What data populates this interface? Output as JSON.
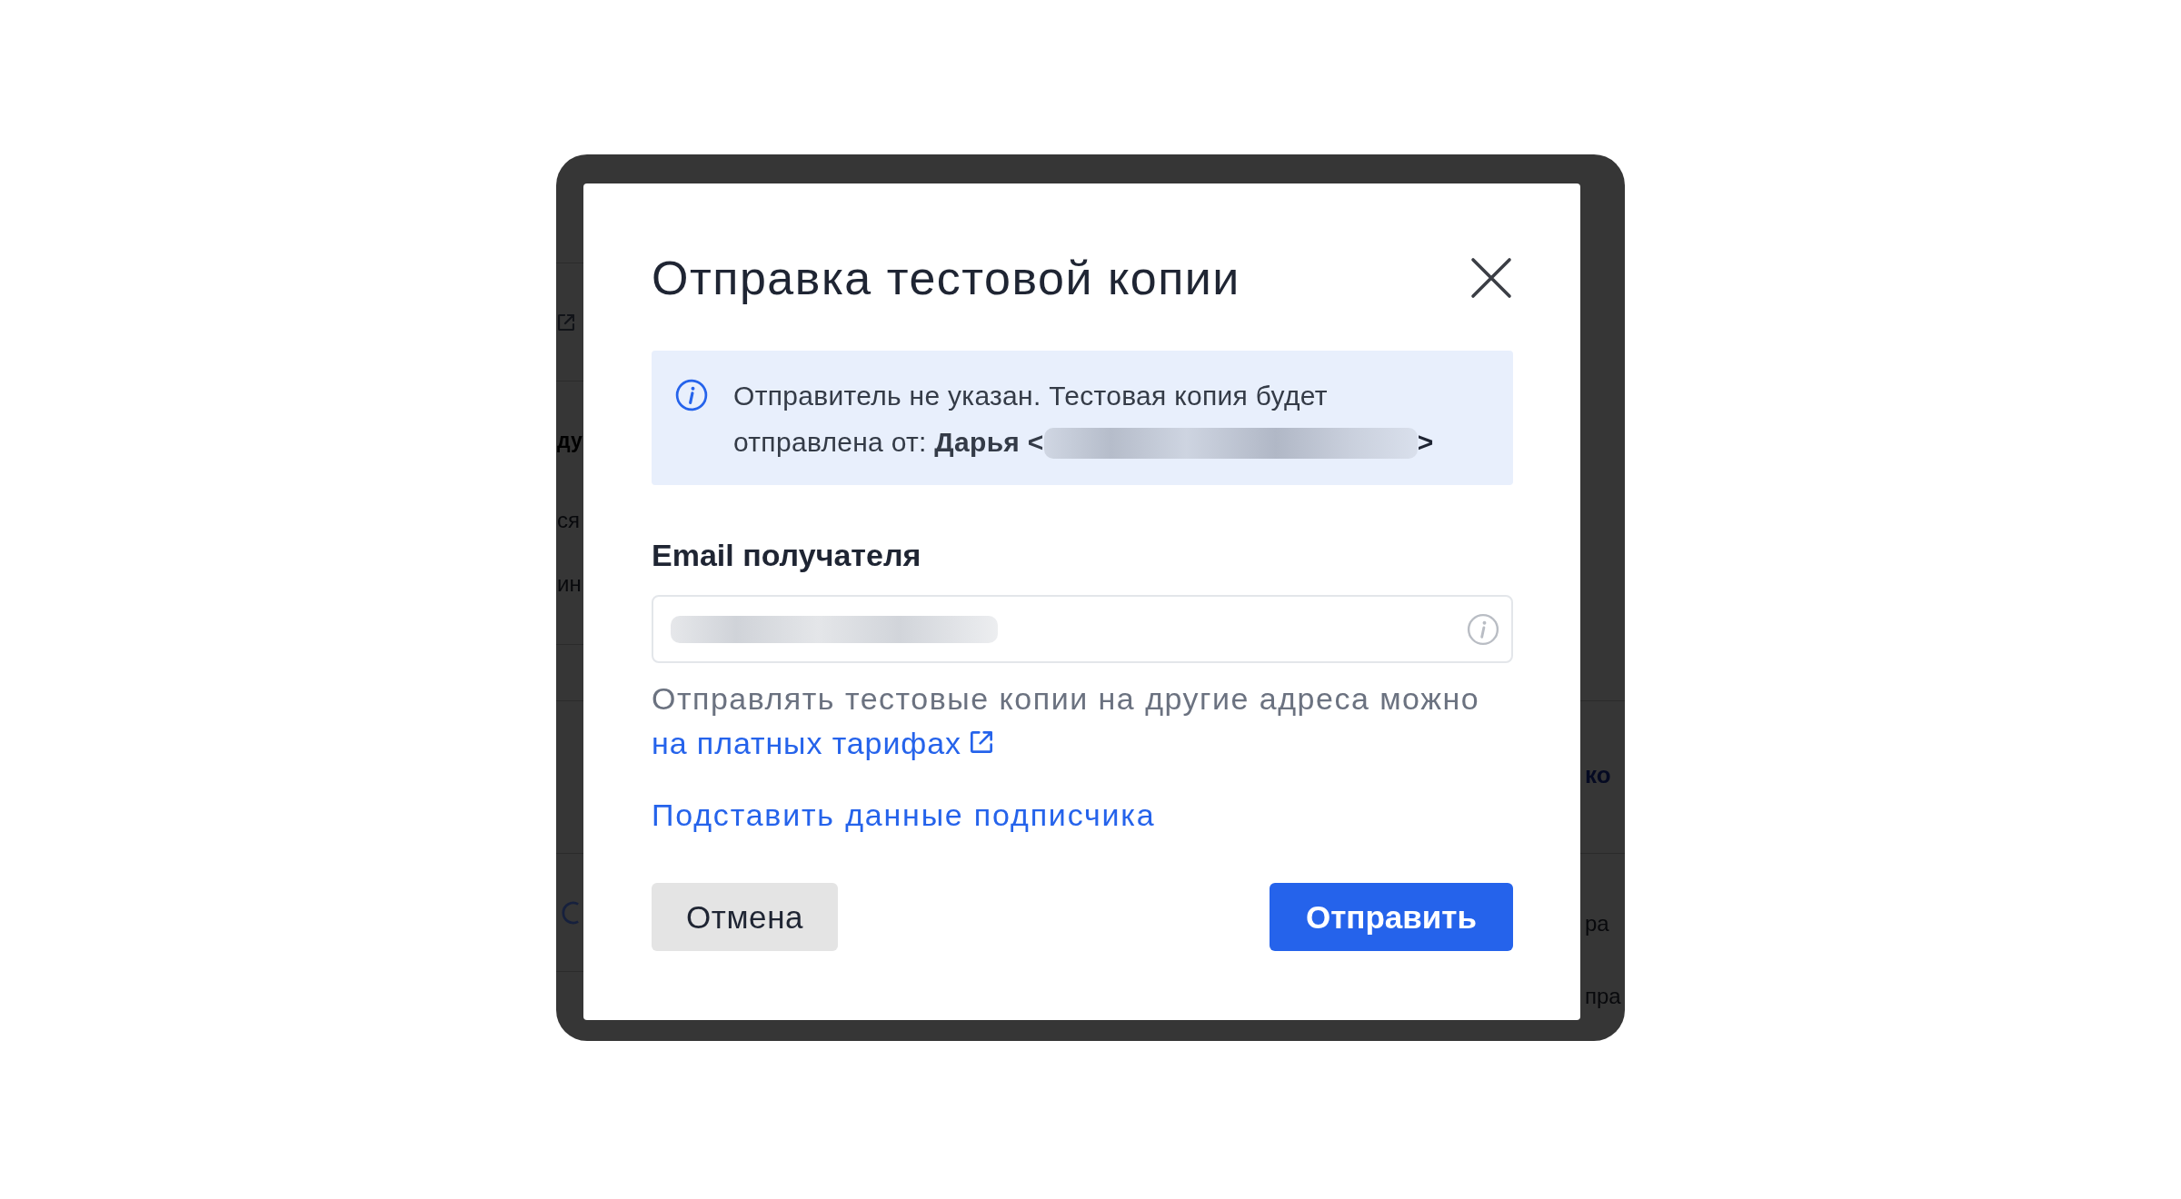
{
  "background_page": {
    "left_fragments": [
      {
        "text": "ду",
        "kind": "heading"
      },
      {
        "text": "ся",
        "kind": "text"
      },
      {
        "text": "ин",
        "kind": "text"
      }
    ],
    "right_fragments": [
      {
        "text": "ко",
        "kind": "link"
      },
      {
        "text": "ра",
        "kind": "text"
      },
      {
        "text": "пра",
        "kind": "text"
      }
    ]
  },
  "dialog": {
    "title": "Отправка тестовой копии",
    "notice": {
      "text": "Отправитель не указан. Тестовая копия будет отправлена от: **Дарья <**",
      "sender_email_hidden": true,
      "text_after": ">"
    },
    "recipient": {
      "label": "Email получателя",
      "value_hidden": true,
      "hint": "Отправлять тестовые копии на другие адреса можно",
      "hint_link": "на платных тарифах"
    },
    "fill_link": "Подставить данные подписчика",
    "buttons": [
      {
        "label": "Отмена",
        "kind": "secondary"
      },
      {
        "label": "Отправить",
        "kind": "primary"
      }
    ]
  }
}
